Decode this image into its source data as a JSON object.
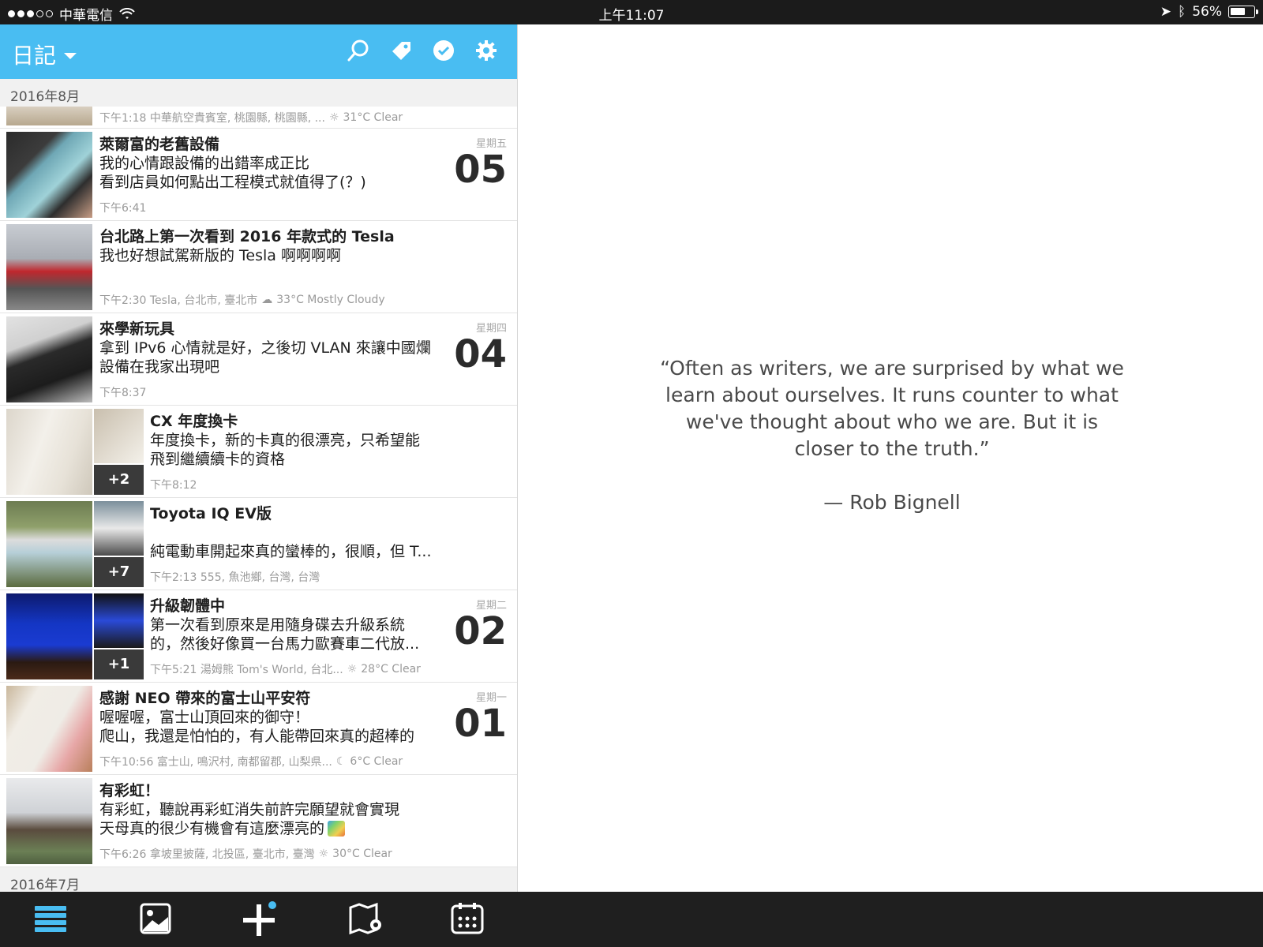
{
  "status": {
    "carrier": "中華電信",
    "time": "上午11:07",
    "battery": "56%",
    "battery_level": 0.56
  },
  "header": {
    "title": "日記",
    "icons": [
      "search-icon",
      "tag-icon",
      "check-circle-icon",
      "gear-icon"
    ],
    "accent": "#49bdf2"
  },
  "month_aug": "2016年8月",
  "month_jul": "2016年7月",
  "entries": {
    "e0": {
      "meta": "下午1:18 中華航空貴賓室, 桃園縣, 桃園縣, ...",
      "weather": "31°C Clear"
    },
    "e1": {
      "title": "萊爾富的老舊設備",
      "line1": "我的心情跟設備的出錯率成正比",
      "line2": "看到店員如何點出工程模式就值得了(？)",
      "meta": "下午6:41",
      "weekday": "星期五",
      "day": "05"
    },
    "e2": {
      "title": "台北路上第一次看到 2016 年款式的 Tesla",
      "line1": "我也好想試駕新版的 Tesla 啊啊啊啊",
      "meta": "下午2:30 Tesla, 台北市, 臺北市",
      "weather": "33°C Mostly Cloudy"
    },
    "e3": {
      "title": "來學新玩具",
      "line1": "拿到 IPv6 心情就是好，之後切 VLAN 來讓中國爛",
      "line2": "設備在我家出現吧",
      "meta": "下午8:37",
      "weekday": "星期四",
      "day": "04"
    },
    "e4": {
      "title": "CX 年度換卡",
      "line1": "年度換卡，新的卡真的很漂亮，只希望能",
      "line2": "飛到繼續續卡的資格",
      "meta": "下午8:12",
      "badge": "+2"
    },
    "e5": {
      "title": "Toyota IQ EV版",
      "line1": "純電動車開起來真的蠻棒的，很順，但 T...",
      "meta": "下午2:13 555, 魚池鄉, 台灣, 台灣",
      "badge": "+7"
    },
    "e6": {
      "title": "升級韌體中",
      "line1": "第一次看到原來是用隨身碟去升級系統",
      "line2": "的，然後好像買一台馬力歐賽車二代放...",
      "meta": "下午5:21 湯姆熊 Tom's World, 台北...",
      "weather": "28°C Clear",
      "badge": "+1",
      "weekday": "星期二",
      "day": "02"
    },
    "e7": {
      "title": "感謝 NEO 帶來的富士山平安符",
      "line1": "喔喔喔，富士山頂回來的御守！",
      "line2": "爬山，我還是怕怕的，有人能帶回來真的超棒的",
      "meta": "下午10:56 富士山, 鳴沢村, 南都留郡, 山梨県...",
      "weather": "6°C Clear",
      "weekday": "星期一",
      "day": "01"
    },
    "e8": {
      "title": "有彩虹！",
      "line1": "有彩虹，聽說再彩虹消失前許完願望就會實現",
      "line2": "天母真的很少有機會有這麼漂亮的",
      "meta": "下午6:26 拿坡里披薩, 北投區, 臺北市, 臺灣",
      "weather": "30°C Clear"
    }
  },
  "quote": {
    "text": "“Often as writers, we are surprised by what we learn about ourselves. It runs counter to what we've thought about who we are. But it is closer to the truth.”",
    "author": "— Rob Bignell"
  },
  "tabbar": {
    "icons": [
      "list-icon",
      "photo-icon",
      "add-icon",
      "map-icon",
      "calendar-icon"
    ],
    "active_color": "#49bdf2"
  }
}
